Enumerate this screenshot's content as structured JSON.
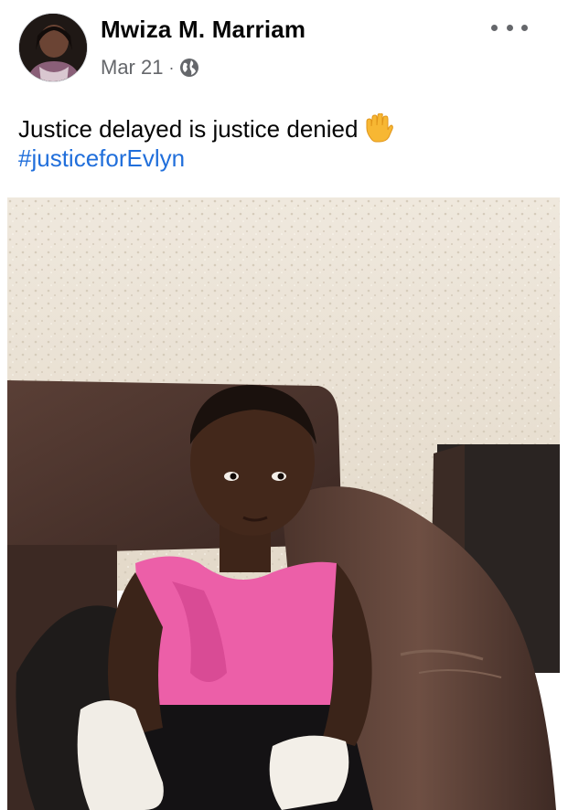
{
  "post": {
    "author_name": "Mwiza M. Marriam",
    "date": "Mar 21",
    "separator": "·",
    "privacy_icon": "globe-icon",
    "more_icon": "more-options-icon",
    "text": "Justice delayed is justice denied",
    "emoji_icon": "raised-hand-emoji",
    "hashtag": "#justiceforEvlyn"
  },
  "colors": {
    "text": "#050505",
    "secondary_text": "#65676b",
    "hashtag": "#216fdb",
    "background": "#ffffff"
  }
}
